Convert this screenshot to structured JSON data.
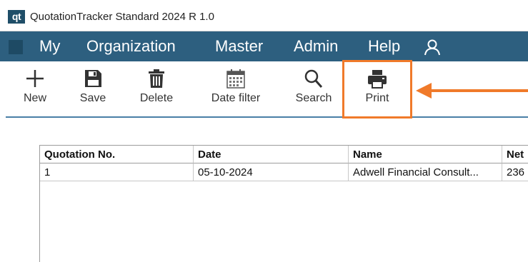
{
  "app": {
    "logo_text": "qt",
    "window_title": "QuotationTracker Standard 2024 R 1.0"
  },
  "menu": [
    "My",
    "Organization",
    "Master",
    "Admin",
    "Help"
  ],
  "toolbar": {
    "new_label": "New",
    "save_label": "Save",
    "delete_label": "Delete",
    "date_filter_label": "Date filter",
    "search_label": "Search",
    "print_label": "Print"
  },
  "table": {
    "columns": [
      "Quotation No.",
      "Date",
      "Name",
      "Net"
    ],
    "rows": [
      [
        "1",
        "05-10-2024",
        "Adwell Financial Consult...",
        "236"
      ]
    ]
  },
  "colors": {
    "menubar": "#2d5f7f",
    "highlight": "#f07a2a",
    "toolbar_separator": "#4a7fa6"
  },
  "icons": {
    "new": "plus-icon",
    "save": "floppy-disk-icon",
    "delete": "trash-icon",
    "date_filter": "calendar-icon",
    "search": "magnifier-icon",
    "print": "printer-icon",
    "user": "user-icon"
  }
}
